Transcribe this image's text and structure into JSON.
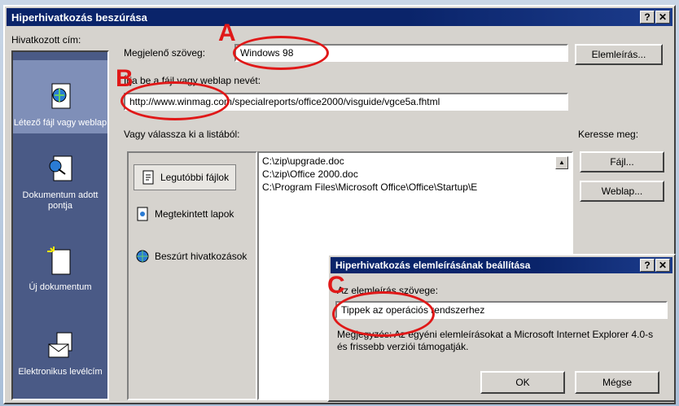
{
  "dialog": {
    "title": "Hiperhivatkozás beszúrása",
    "help_btn": "?",
    "close_btn": "✕",
    "link_to_label": "Hivatkozott cím:",
    "link_to_items": [
      {
        "label": "Létező fájl vagy weblap"
      },
      {
        "label": "Dokumentum adott pontja"
      },
      {
        "label": "Új dokumentum"
      },
      {
        "label": "Elektronikus levélcím"
      }
    ],
    "display_text_label": "Megjelenő szöveg:",
    "display_text_value": "Windows 98",
    "screentip_button": "Elemleírás...",
    "filename_label": "Írja be a fájl vagy weblap nevét:",
    "filename_value": "http://www.winmag.com/specialreports/office2000/visguide/vgce5a.fhtml",
    "choose_label": "Vagy válassza ki a listából:",
    "browse_label": "Keresse meg:",
    "browse_file_button": "Fájl...",
    "browse_web_button": "Weblap...",
    "side_items": [
      {
        "label": "Legutóbbi fájlok"
      },
      {
        "label": "Megtekintett lapok"
      },
      {
        "label": "Beszúrt hivatkozások"
      }
    ],
    "list_items": [
      "C:\\zip\\upgrade.doc",
      "C:\\zip\\Office 2000.doc",
      "C:\\Program Files\\Microsoft Office\\Office\\Startup\\E"
    ]
  },
  "subdialog": {
    "title": "Hiperhivatkozás elemleírásának beállítása",
    "help_btn": "?",
    "close_btn": "✕",
    "text_label": "Az elemleírás szövege:",
    "text_value": "Tippek az operációs rendszerhez",
    "note": "Megjegyzés: Az egyéni elemleírásokat a Microsoft Internet Explorer 4.0-s és frissebb verziói támogatják.",
    "ok_button": "OK",
    "cancel_button": "Mégse"
  },
  "markers": [
    "A",
    "B",
    "C"
  ],
  "colors": {
    "annotation": "#e01818",
    "titlebar": "#0a246a",
    "linkto_pane": "#4a5a86"
  }
}
